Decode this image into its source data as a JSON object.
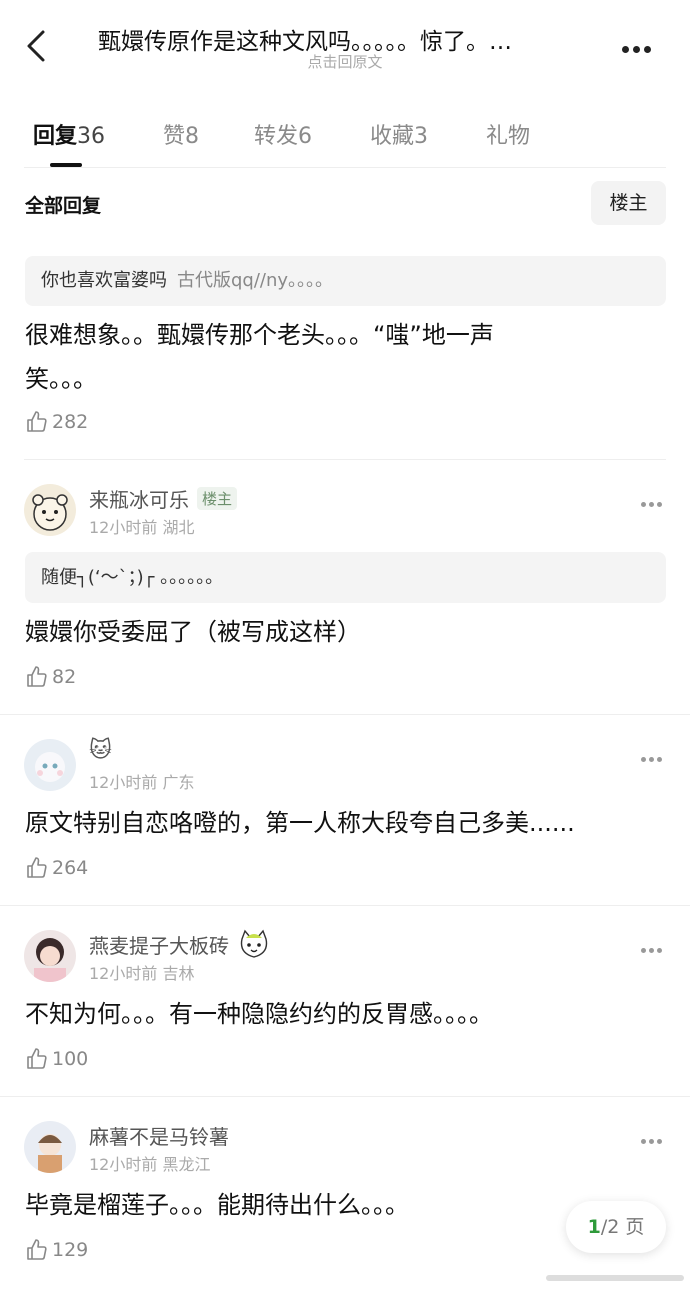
{
  "header": {
    "back_icon": "chevron-left-icon",
    "title": "甄嬛传原作是这种文风吗。。。。。惊了。…",
    "subtitle": "点击回原文",
    "more_icon": "more-horizontal-icon"
  },
  "tabs": [
    {
      "label": "回复",
      "count": "36"
    },
    {
      "label": "赞",
      "count": "8"
    },
    {
      "label": "转发",
      "count": "6"
    },
    {
      "label": "收藏",
      "count": "3"
    },
    {
      "label": "礼物",
      "count": ""
    }
  ],
  "filter": {
    "all_label": "全部回复",
    "op_label": "楼主"
  },
  "comments": [
    {
      "quote_text": "你也喜欢富婆吗",
      "quote_sub": "古代版qq//ny。。。。",
      "text_line1": "很难想象。。甄嬛传那个老头。。。“嗤”地一声",
      "text_line2": "笑。。。",
      "likes": "282"
    },
    {
      "name": "来瓶冰可乐",
      "badge": "楼主",
      "meta": "12小时前 湖北",
      "quote_text": "随便┐(‘～`；)┌ 。。。。。。",
      "text": "嬛嬛你受委屈了（被写成这样）",
      "likes": "82"
    },
    {
      "name": "🐱",
      "meta": "12小时前 广东",
      "text": "原文特别自恋咯噔的，第一人称大段夸自己多美......",
      "likes": "264"
    },
    {
      "name": "燕麦提子大板砖",
      "meta": "12小时前 吉林",
      "text": "不知为何。。。有一种隐隐约约的反胃感。。。。",
      "likes": "100"
    },
    {
      "name": "麻薯不是马铃薯",
      "meta": "12小时前 黑龙江",
      "text": "毕竟是榴莲子。。。能期待出什么。。。",
      "likes": "129"
    }
  ],
  "pager": {
    "current": "1",
    "total_text": "/2 页"
  },
  "colors": {
    "accent_green": "#2e9a3a",
    "muted": "#888888",
    "quote_bg": "#f4f4f4"
  }
}
